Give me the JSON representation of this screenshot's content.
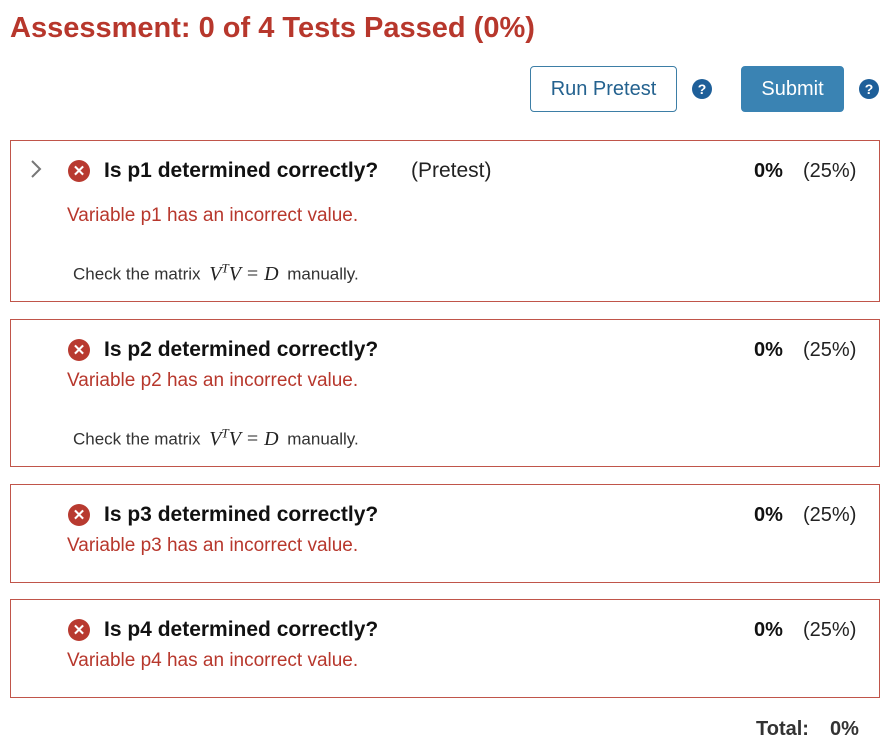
{
  "header": {
    "title": "Assessment: 0 of 4 Tests Passed (0%)"
  },
  "toolbar": {
    "run_pretest_label": "Run Pretest",
    "submit_label": "Submit",
    "help_glyph": "?"
  },
  "tests": [
    {
      "title": "Is p1 determined correctly?",
      "tag": "(Pretest)",
      "score": "0%",
      "weight": "(25%)",
      "message": "Variable p1 has an incorrect value.",
      "hint_prefix": "Check the matrix",
      "hint_math_base": "V",
      "hint_math_sup": "T",
      "hint_math_rest": "V = D",
      "hint_suffix": "manually."
    },
    {
      "title": "Is p2 determined correctly?",
      "score": "0%",
      "weight": "(25%)",
      "message": "Variable p2 has an incorrect value.",
      "hint_prefix": "Check the matrix",
      "hint_math_base": "V",
      "hint_math_sup": "T",
      "hint_math_rest": "V = D",
      "hint_suffix": "manually."
    },
    {
      "title": "Is p3 determined correctly?",
      "score": "0%",
      "weight": "(25%)",
      "message": "Variable p3 has an incorrect value."
    },
    {
      "title": "Is p4 determined correctly?",
      "score": "0%",
      "weight": "(25%)",
      "message": "Variable p4 has an incorrect value."
    }
  ],
  "footer": {
    "total_label": "Total:",
    "total_value": "0%"
  },
  "icons": {
    "fail": "x-circle-icon",
    "expand": "chevron-right-icon",
    "help": "question-circle-icon"
  },
  "colors": {
    "title": "#b7372c",
    "fail": "#b83a30",
    "border": "#c0554a",
    "primary": "#3a83b3",
    "help": "#1e5f99"
  }
}
